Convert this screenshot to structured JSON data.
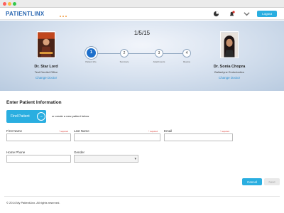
{
  "header": {
    "logo_text": "PATIENTLINX",
    "logout_label": "Logout",
    "icons": [
      "chart-icon",
      "notification-icon",
      "chevron-down-icon"
    ]
  },
  "appointment": {
    "date": "1/5/15",
    "doctor_left": {
      "name": "Dr. Star Lord",
      "office": "Test Dentist Office",
      "change_label": "Change Doctor"
    },
    "doctor_right": {
      "name": "Dr. Sonia Chopra",
      "office": "Ballantyne Endodontics",
      "change_label": "Change Doctor"
    }
  },
  "steps": [
    {
      "number": "1",
      "label": "Patient Info"
    },
    {
      "number": "2",
      "label": "Summary"
    },
    {
      "number": "3",
      "label": "Attachments"
    },
    {
      "number": "4",
      "label": "Review"
    }
  ],
  "form": {
    "title": "Enter Patient Information",
    "find_patient_label": "Find Patient",
    "or_text": "or create a new patient below",
    "required_text": "* required",
    "first_name_label": "First Name",
    "last_name_label": "Last Name",
    "email_label": "Email",
    "home_phone_label": "Home Phone",
    "gender_label": "Gender",
    "cancel_label": "Cancel",
    "next_label": "Next"
  },
  "footer": {
    "copyright": "© 2014 My PatientLinx. All rights reserved."
  },
  "colors": {
    "accent": "#2aaee0",
    "brand": "#2a67b1",
    "step_active": "#1d6fcb",
    "required": "#d9342b"
  }
}
